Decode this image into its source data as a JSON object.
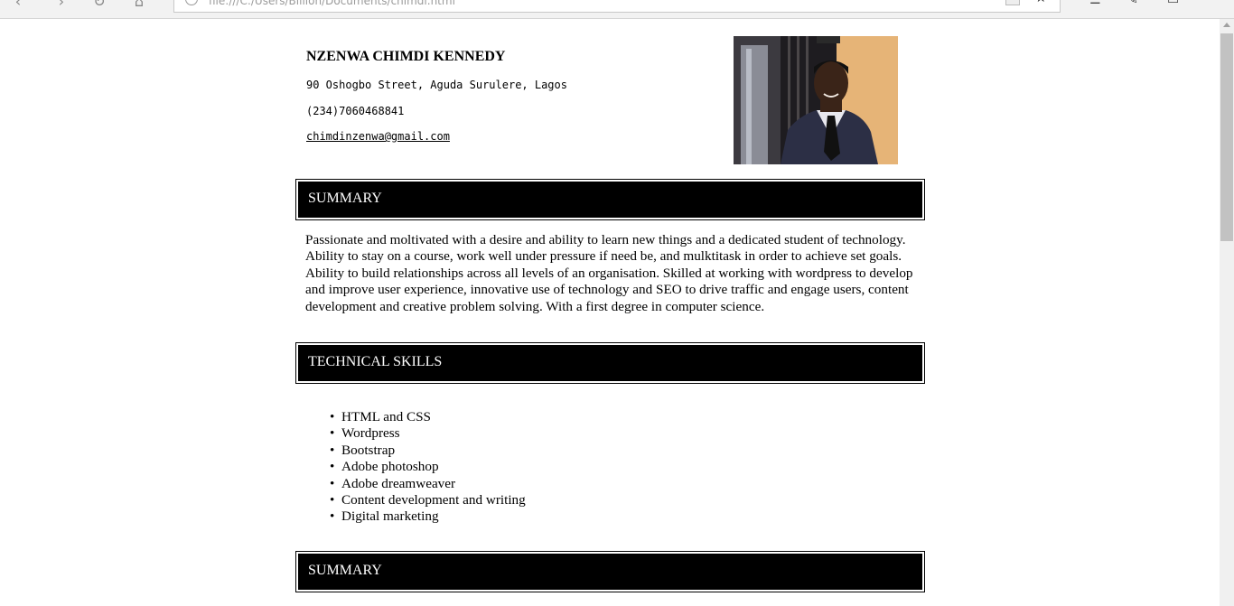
{
  "browser": {
    "url": "file:///C:/Users/Billion/Documents/chimdi.html"
  },
  "resume": {
    "name": "NZENWA CHIMDI KENNEDY",
    "address": "90 Oshogbo Street, Aguda Surulere, Lagos",
    "phone": "(234)7060468841",
    "email": "chimdinzenwa@gmail.com",
    "sections": {
      "summary_title": "SUMMARY",
      "summary_text": "Passionate and moltivated with a desire and ability to learn new things and a dedicated student of technology. Ability to stay on a course, work well under pressure if need be, and mulktitask in order to achieve set goals. Ability to build relationships across all levels of an organisation. Skilled at working with wordpress to develop and improve user experience, innovative use of technology and SEO to drive traffic and engage users, content development and creative problem solving. With a first degree in computer science.",
      "skills_title": "TECHNICAL SKILLS",
      "skills": [
        "HTML and CSS",
        "Wordpress",
        "Bootstrap",
        "Adobe photoshop",
        "Adobe dreamweaver",
        "Content development and writing",
        "Digital marketing"
      ],
      "second_summary_title": "SUMMARY"
    }
  },
  "colors": {
    "section_bar": "#000000",
    "section_text": "#ffffff",
    "photo_background": "#e8b878"
  }
}
